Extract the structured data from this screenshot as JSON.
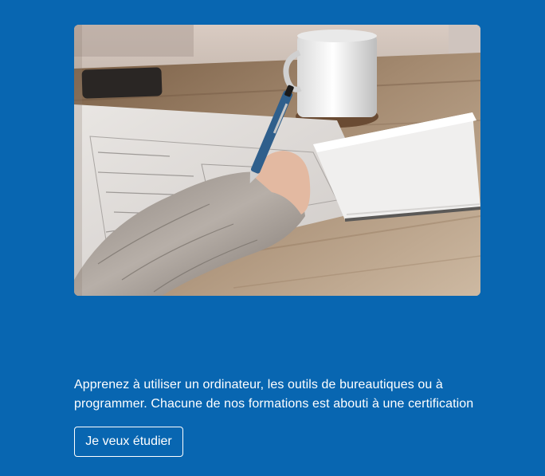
{
  "hero": {
    "image": "person-writing-with-pen-on-paper-photo"
  },
  "content": {
    "description": "Apprenez à utiliser un ordinateur, les outils de bureautiques ou à programmer. Chacune de nos formations est abouti à une certification"
  },
  "cta": {
    "label": "Je veux étudier"
  },
  "colors": {
    "background": "#0866b1",
    "text": "#ffffff",
    "button_border": "#ffffff"
  }
}
